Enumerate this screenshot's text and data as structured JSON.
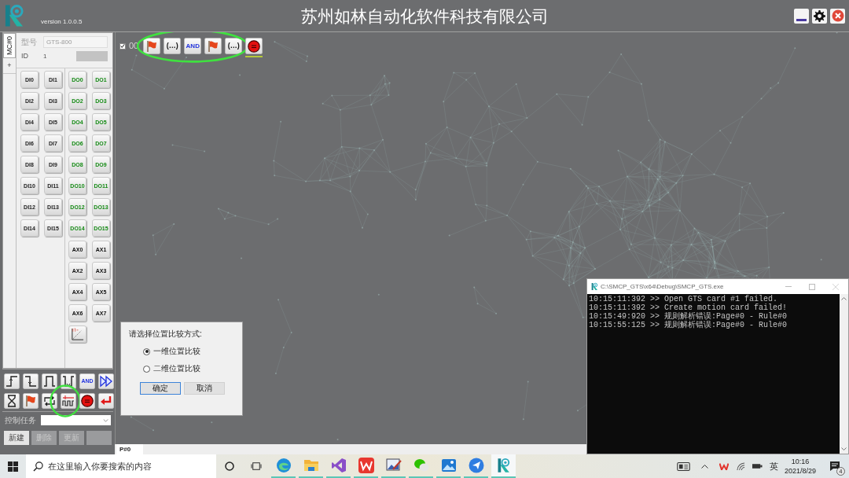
{
  "header": {
    "version": "version 1.0.0.5",
    "title": "苏州如林自动化软件科技有限公司"
  },
  "card_tabs": [
    {
      "label": "MC#0",
      "selected": true
    },
    {
      "label": "+",
      "selected": false
    }
  ],
  "card_info": {
    "model_label": "型号",
    "model_value": "GTS-800",
    "id_label": "ID",
    "id_value": "1"
  },
  "digital_inputs": [
    "DI0",
    "DI1",
    "DI2",
    "DI3",
    "DI4",
    "DI5",
    "DI6",
    "DI7",
    "DI8",
    "DI9",
    "DI10",
    "DI11",
    "DI12",
    "DI13",
    "DI14",
    "DI15"
  ],
  "digital_outputs": [
    "DO0",
    "DO1",
    "DO2",
    "DO3",
    "DO4",
    "DO5",
    "DO6",
    "DO7",
    "DO8",
    "DO9",
    "DO10",
    "DO11",
    "DO12",
    "DO13",
    "DO14",
    "DO15"
  ],
  "axes": [
    "AX0",
    "AX1",
    "AX2",
    "AX3",
    "AX4",
    "AX5",
    "AX6",
    "AX7"
  ],
  "tool_palette": [
    {
      "kind": "rising_edge",
      "circled": false
    },
    {
      "kind": "falling_edge",
      "circled": false
    },
    {
      "kind": "pulse_high",
      "circled": false
    },
    {
      "kind": "pulse_low",
      "circled": false
    },
    {
      "kind": "and",
      "label": "AND",
      "circled": false
    },
    {
      "kind": "fast_forward",
      "circled": false
    },
    {
      "kind": "timer",
      "circled": false
    },
    {
      "kind": "flag",
      "circled": false
    },
    {
      "kind": "loop",
      "circled": false
    },
    {
      "kind": "position_compare",
      "circled": true
    },
    {
      "kind": "stop",
      "circled": false
    },
    {
      "kind": "return",
      "circled": false
    }
  ],
  "task": {
    "label": "控制任务",
    "buttons": [
      {
        "label": "新建",
        "disabled": false
      },
      {
        "label": "删除",
        "disabled": true
      },
      {
        "label": "更新",
        "disabled": true
      },
      {
        "disabled": true
      }
    ]
  },
  "rule": {
    "checked": true,
    "label": "00",
    "elements": [
      {
        "kind": "flag",
        "circled": true,
        "selected": false
      },
      {
        "kind": "bracket",
        "label": "(…)",
        "circled": true,
        "selected": false
      },
      {
        "kind": "and",
        "label": "AND",
        "circled": true,
        "selected": false
      },
      {
        "kind": "flag",
        "circled": true,
        "selected": false
      },
      {
        "kind": "bracket",
        "label": "(…)",
        "circled": true,
        "selected": false
      },
      {
        "kind": "stop",
        "circled": false,
        "selected": true
      }
    ]
  },
  "dialog": {
    "prompt": "请选择位置比较方式:",
    "options": [
      {
        "label": "一维位置比较",
        "selected": true
      },
      {
        "label": "二维位置比较",
        "selected": false
      }
    ],
    "buttons": [
      {
        "label": "确定",
        "default": true
      },
      {
        "label": "取消",
        "default": false
      }
    ]
  },
  "page_tabs": [
    {
      "label": "P#0",
      "selected": true
    }
  ],
  "console": {
    "title": "C:\\SMCP_GTS\\x64\\Debug\\SMCP_GTS.exe",
    "lines": [
      "10:15:11:392 >> Open GTS card #1 failed.",
      "10:15:11:392 >> Create motion card failed!",
      "10:15:49:920 >> 规则解析错误:Page#0 - Rule#0",
      "10:15:55:125 >> 规则解析错误:Page#0 - Rule#0"
    ]
  },
  "taskbar": {
    "search_placeholder": "在这里输入你要搜索的内容",
    "apps": [
      {
        "kind": "browser",
        "running": true,
        "active": false
      },
      {
        "kind": "folder",
        "running": true,
        "active": false
      },
      {
        "kind": "infinity",
        "running": true,
        "active": false
      },
      {
        "kind": "w_logo",
        "running": true,
        "active": false
      },
      {
        "kind": "painting",
        "running": true,
        "active": false
      },
      {
        "kind": "chat",
        "running": true,
        "active": false
      },
      {
        "kind": "picture",
        "running": true,
        "active": false
      },
      {
        "kind": "paper_plane",
        "running": true,
        "active": false
      },
      {
        "kind": "r_logo",
        "running": true,
        "active": true
      }
    ],
    "tray": {
      "language": "英",
      "time": "10:16",
      "date": "2021/8/29",
      "notifications": "4"
    }
  }
}
